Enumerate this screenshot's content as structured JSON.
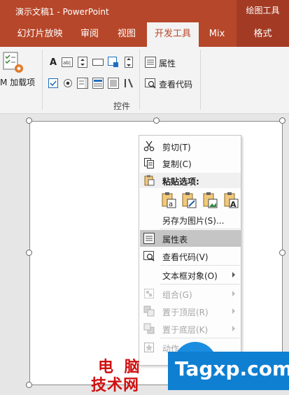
{
  "titlebar": {
    "title": "演示文稿1  -  PowerPoint",
    "context_group": "绘图工具",
    "accent": "#b7472a"
  },
  "tabs": [
    {
      "label": "幻灯片放映"
    },
    {
      "label": "审阅"
    },
    {
      "label": "视图"
    },
    {
      "label": "开发工具",
      "active": true
    },
    {
      "label": "Mix"
    },
    {
      "label": "格式",
      "context": true
    }
  ],
  "ribbon": {
    "addins_label": "M 加载项",
    "properties_label": "属性",
    "viewcode_label": "查看代码",
    "group_label": "控件"
  },
  "context_menu": {
    "cut": "剪切(T)",
    "copy": "复制(C)",
    "paste_header": "粘贴选项:",
    "save_as_picture": "另存为图片(S)...",
    "property_sheet": "属性表",
    "view_code": "查看代码(V)",
    "textbox_object": "文本框对象(O)",
    "group": "组合(G)",
    "bring_to_front": "置于顶层(R)",
    "send_to_back": "置于底层(K)",
    "action": "动作"
  },
  "watermark": {
    "line1": "电 脑",
    "line2": "技术网",
    "site": "Tagxp.com"
  }
}
